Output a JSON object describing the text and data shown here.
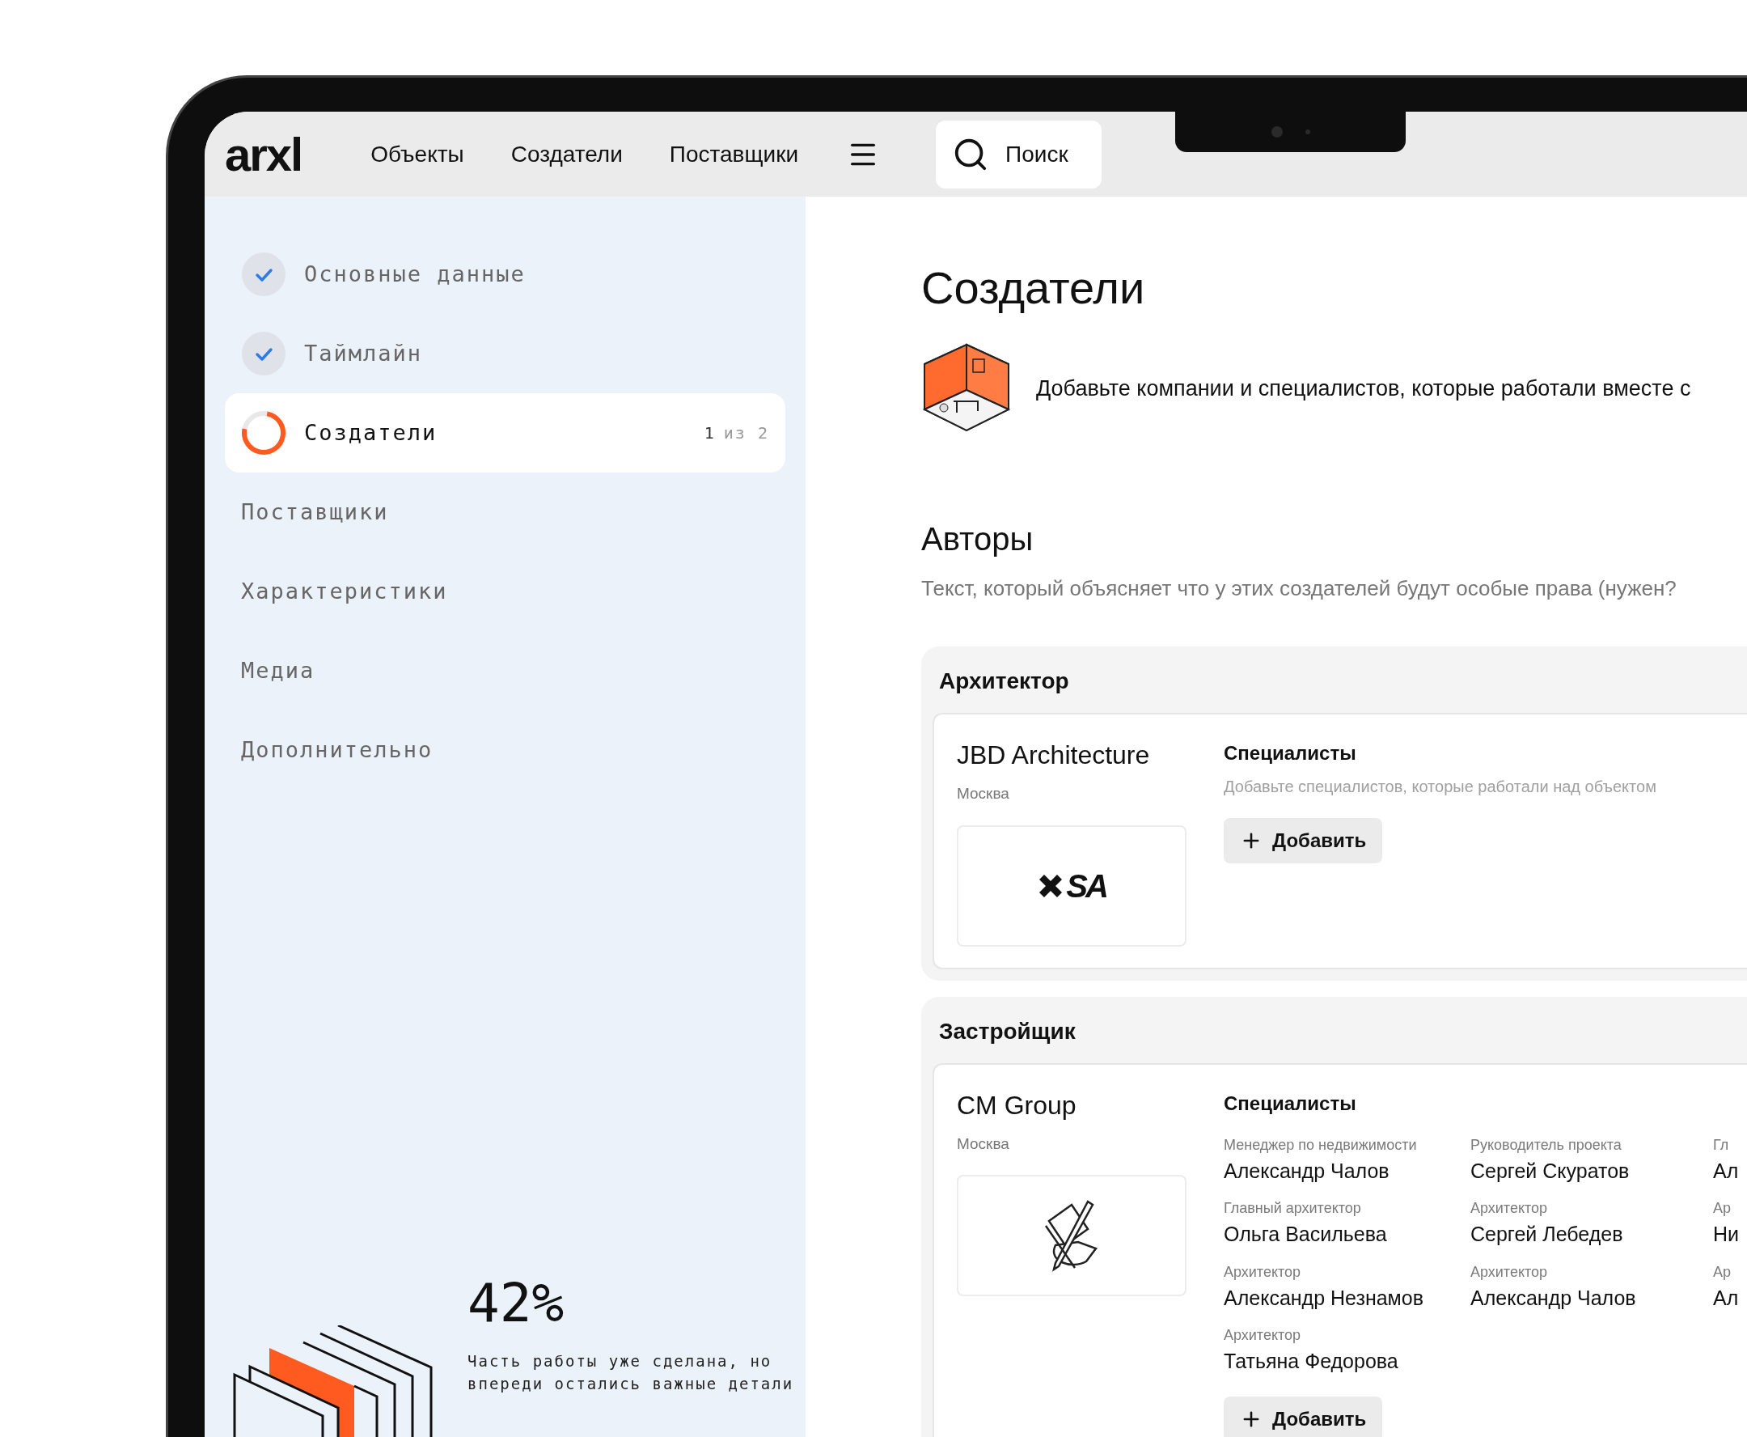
{
  "topbar": {
    "logo": "arxl",
    "nav": [
      {
        "label": "Объекты"
      },
      {
        "label": "Создатели"
      },
      {
        "label": "Поставщики"
      }
    ],
    "search": {
      "label": "Поиск"
    }
  },
  "sidebar": {
    "steps": [
      {
        "label": "Основные данные",
        "kind": "done",
        "selected": false
      },
      {
        "label": "Таймлайн",
        "kind": "done",
        "selected": false
      },
      {
        "label": "Создатели",
        "kind": "current",
        "selected": true,
        "count": "1",
        "total": "из 2"
      },
      {
        "label": "Поставщики",
        "kind": "pending",
        "selected": false
      },
      {
        "label": "Характеристики",
        "kind": "pending",
        "selected": false
      },
      {
        "label": "Медиа",
        "kind": "pending",
        "selected": false
      },
      {
        "label": "Дополнительно",
        "kind": "pending",
        "selected": false
      }
    ],
    "progress": {
      "percent": "42%",
      "text": "Часть работы уже сделана, но впереди остались важные детали"
    }
  },
  "main": {
    "title": "Создатели",
    "intro": "Добавьте компании и специалистов, которые работали вместе с",
    "section": {
      "title": "Авторы",
      "subtitle": "Текст, который объясняет что у этих создателей будут особые права (нужен?",
      "groups": [
        {
          "role": "Архитектор",
          "company": "JBD Architecture",
          "city": "Москва",
          "kind": "xsa",
          "logo_text": "SA",
          "specialists_title": "Специалисты",
          "hint": "Добавьте специалистов, которые работали над объектом",
          "add_label": "Добавить"
        },
        {
          "role": "Застройщик",
          "company": "CM Group",
          "city": "Москва",
          "kind": "sketch",
          "specialists_title": "Специалисты",
          "specialists": [
            {
              "role": "Менеджер по недвижимости",
              "name": "Александр Чалов"
            },
            {
              "role": "Руководитель проекта",
              "name": "Сергей Скуратов"
            },
            {
              "role": "Гл",
              "name": "Ал"
            },
            {
              "role": "Главный архитектор",
              "name": "Ольга Васильева"
            },
            {
              "role": "Архитектор",
              "name": "Сергей Лебедев"
            },
            {
              "role": "Ар",
              "name": "Ни"
            },
            {
              "role": "Архитектор",
              "name": "Александр Незнамов"
            },
            {
              "role": "Архитектор",
              "name": "Александр Чалов"
            },
            {
              "role": "Ар",
              "name": "Ал"
            },
            {
              "role": "Архитектор",
              "name": "Татьяна Федорова"
            }
          ],
          "add_label": "Добавить"
        }
      ]
    }
  }
}
